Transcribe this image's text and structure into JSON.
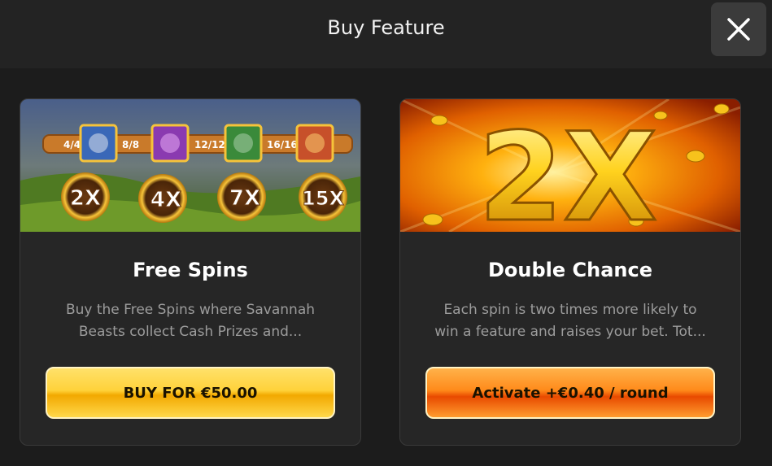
{
  "header": {
    "title": "Buy Feature"
  },
  "close_button": {
    "icon": "close-icon"
  },
  "cards": [
    {
      "title": "Free Spins",
      "description_line1": "Buy the Free Spins where Savannah",
      "description_line2": "Beasts collect Cash Prizes and...",
      "button_label": "BUY FOR €50.00",
      "banner": {
        "counters": [
          "4/4",
          "8/8",
          "12/12",
          "16/16"
        ],
        "multipliers": [
          "2X",
          "4X",
          "7X",
          "15X"
        ]
      }
    },
    {
      "title": "Double Chance",
      "description_line1": "Each spin is two times more likely to",
      "description_line2": "win a feature and raises your bet. Tot...",
      "button_label": "Activate +€0.40 / round",
      "banner": {
        "big_text": "2X"
      }
    }
  ],
  "colors": {
    "background": "#1c1c1c",
    "gold_button": "#ffd23a",
    "orange_button": "#ff8a1a"
  }
}
